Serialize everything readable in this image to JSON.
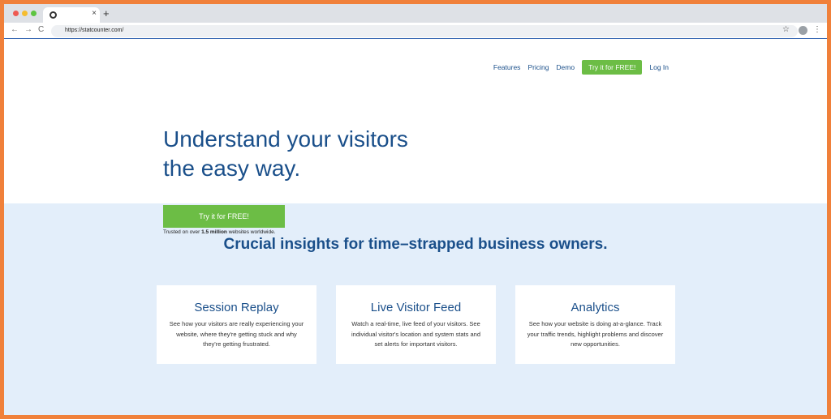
{
  "browser": {
    "url": "https://statcounter.com/",
    "tab_close": "×",
    "new_tab": "+",
    "back": "←",
    "forward": "→",
    "reload": "C",
    "bookmark": "☆",
    "menu": "⋮"
  },
  "nav": {
    "items": [
      {
        "label": "Features"
      },
      {
        "label": "Pricing"
      },
      {
        "label": "Demo"
      }
    ],
    "cta_label": "Try it for FREE!",
    "login_label": "Log In"
  },
  "hero": {
    "headline_line1": "Understand your visitors",
    "headline_line2": "the easy way.",
    "cta_label": "Try it for FREE!",
    "trusted_prefix": "Trusted on over ",
    "trusted_bold": "1.5 million",
    "trusted_suffix": " websites worldwide."
  },
  "insights": {
    "heading": "Crucial insights for time–strapped business owners.",
    "cards": [
      {
        "title": "Session Replay",
        "body": "See how your visitors are really experiencing your website, where they're getting stuck and why they're getting frustrated."
      },
      {
        "title": "Live Visitor Feed",
        "body": "Watch a real-time, live feed of your visitors. See individual visitor's location and system stats and set alerts for important visitors."
      },
      {
        "title": "Analytics",
        "body": "See how your website is doing at-a-glance. Track your traffic trends, highlight problems and discover new opportunities."
      }
    ]
  },
  "colors": {
    "brand_blue": "#1a4f8a",
    "cta_green": "#6cbd45",
    "section_bg": "#e3eefa",
    "frame_orange": "#f0803a"
  }
}
